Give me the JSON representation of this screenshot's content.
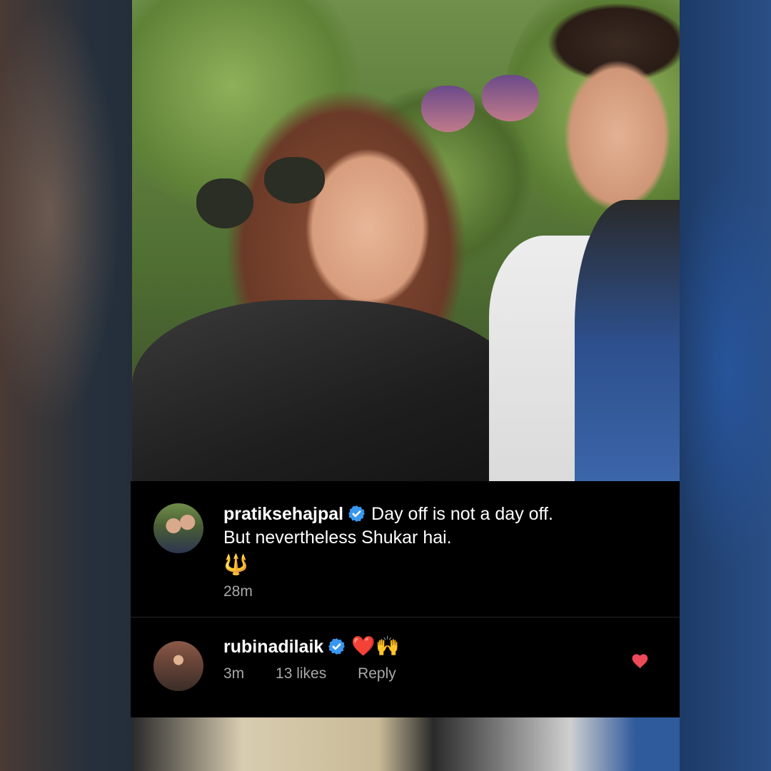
{
  "comments": [
    {
      "username": "pratiksehajpal",
      "verified": true,
      "text_line1": "Day off is not a day off.",
      "text_line2": "But nevertheless Shukar hai.",
      "emoji": "🔱",
      "time": "28m"
    },
    {
      "username": "rubinadilaik",
      "verified": true,
      "text_heart": "❤️",
      "text_clap": "🙌",
      "time": "3m",
      "likes": "13 likes",
      "reply": "Reply",
      "liked": true
    }
  ],
  "colors": {
    "background": "#000000",
    "verified_badge": "#3897f0",
    "like_heart": "#ed4956",
    "meta_text": "#a8a8a8"
  },
  "icons": [
    "verified-badge-icon",
    "heart-icon",
    "trident-emoji",
    "raised-hands-emoji"
  ]
}
